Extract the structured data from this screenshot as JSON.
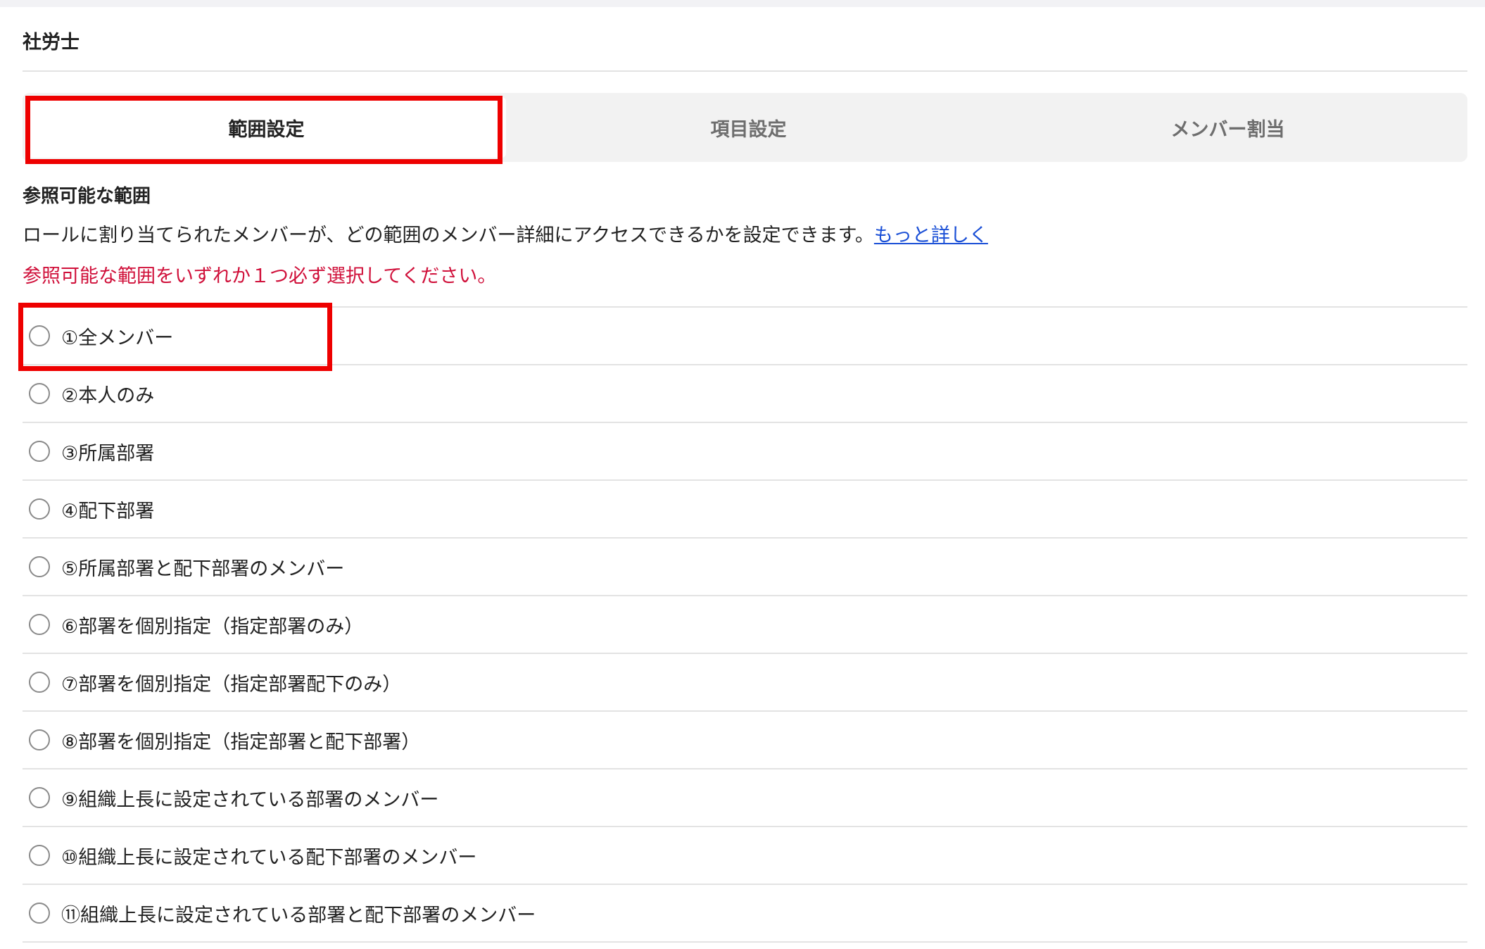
{
  "page": {
    "title": "社労士"
  },
  "tabs": [
    {
      "label": "範囲設定",
      "active": true
    },
    {
      "label": "項目設定",
      "active": false
    },
    {
      "label": "メンバー割当",
      "active": false
    }
  ],
  "scope": {
    "heading": "参照可能な範囲",
    "description": "ロールに割り当てられたメンバーが、どの範囲のメンバー詳細にアクセスできるかを設定できます。",
    "more_link": "もっと詳しく",
    "error": "参照可能な範囲をいずれか１つ必ず選択してください。",
    "options": [
      {
        "label": "①全メンバー",
        "selected": false
      },
      {
        "label": "②本人のみ",
        "selected": false
      },
      {
        "label": "③所属部署",
        "selected": false
      },
      {
        "label": "④配下部署",
        "selected": false
      },
      {
        "label": "⑤所属部署と配下部署のメンバー",
        "selected": false
      },
      {
        "label": "⑥部署を個別指定（指定部署のみ）",
        "selected": false
      },
      {
        "label": "⑦部署を個別指定（指定部署配下のみ）",
        "selected": false
      },
      {
        "label": "⑧部署を個別指定（指定部署と配下部署）",
        "selected": false
      },
      {
        "label": "⑨組織上長に設定されている部署のメンバー",
        "selected": false
      },
      {
        "label": "⑩組織上長に設定されている配下部署のメンバー",
        "selected": false
      },
      {
        "label": "⑪組織上長に設定されている部署と配下部署のメンバー",
        "selected": false
      }
    ]
  },
  "colors": {
    "highlight": "#ee0000",
    "error": "#d0103a",
    "link": "#1a4fd6"
  }
}
